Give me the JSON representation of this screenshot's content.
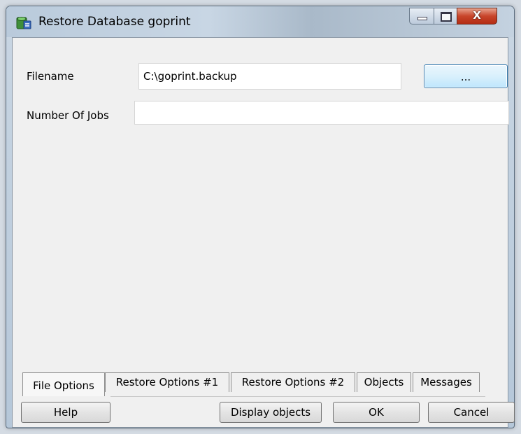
{
  "window": {
    "title": "Restore Database goprint",
    "icon": "database-restore-icon",
    "close_glyph": "X"
  },
  "form": {
    "filename_label": "Filename",
    "filename_value": "C:\\goprint.backup",
    "browse_label": "...",
    "jobs_label": "Number Of Jobs",
    "jobs_value": ""
  },
  "tabs": [
    {
      "label": "File Options",
      "active": true
    },
    {
      "label": "Restore Options #1",
      "active": false
    },
    {
      "label": "Restore Options #2",
      "active": false
    },
    {
      "label": "Objects",
      "active": false
    },
    {
      "label": "Messages",
      "active": false
    }
  ],
  "buttons": {
    "help": "Help",
    "display_objects": "Display objects",
    "ok": "OK",
    "cancel": "Cancel"
  }
}
